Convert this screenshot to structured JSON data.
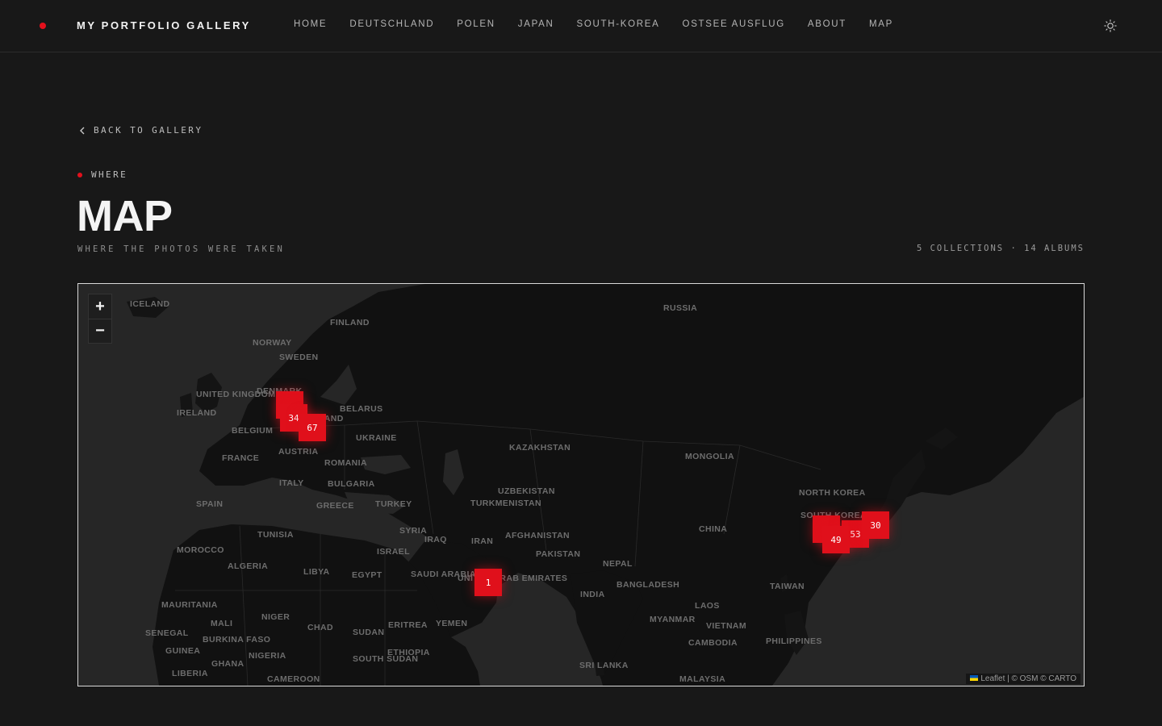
{
  "header": {
    "brand": "MY PORTFOLIO GALLERY",
    "nav": [
      "HOME",
      "DEUTSCHLAND",
      "POLEN",
      "JAPAN",
      "SOUTH-KOREA",
      "OSTSEE AUSFLUG",
      "ABOUT",
      "MAP"
    ]
  },
  "back_label": "BACK TO GALLERY",
  "eyebrow": "WHERE",
  "title": "MAP",
  "subtitle": "WHERE THE PHOTOS WERE TAKEN",
  "stats": "5 COLLECTIONS · 14 ALBUMS",
  "map": {
    "zoom_in": "+",
    "zoom_out": "−",
    "attribution": "Leaflet | © OSM © CARTO",
    "clusters": [
      {
        "name": "cluster-europe-a",
        "label": ""
      },
      {
        "name": "cluster-europe-34",
        "label": "34"
      },
      {
        "name": "cluster-europe-67",
        "label": "67"
      },
      {
        "name": "cluster-middle-east-1",
        "label": "1"
      },
      {
        "name": "cluster-korea",
        "label": "1"
      },
      {
        "name": "cluster-japan-49",
        "label": "49"
      },
      {
        "name": "cluster-japan-53",
        "label": "53"
      },
      {
        "name": "cluster-japan-30",
        "label": "30"
      }
    ],
    "labels": [
      "RUSSIA",
      "ICELAND",
      "FINLAND",
      "NORWAY",
      "SWEDEN",
      "DENMARK",
      "UNITED KINGDOM",
      "IRELAND",
      "BELGIUM",
      "POLAND",
      "BELARUS",
      "UKRAINE",
      "FRANCE",
      "AUSTRIA",
      "ROMANIA",
      "BULGARIA",
      "ITALY",
      "SPAIN",
      "GREECE",
      "TURKEY",
      "TUNISIA",
      "MOROCCO",
      "ALGERIA",
      "LIBYA",
      "EGYPT",
      "ISRAEL",
      "SYRIA",
      "IRAQ",
      "IRAN",
      "SAUDI ARABIA",
      "UNITED ARAB EMIRATES",
      "KAZAKHSTAN",
      "UZBEKISTAN",
      "TURKMENISTAN",
      "AFGHANISTAN",
      "PAKISTAN",
      "MONGOLIA",
      "CHINA",
      "NORTH KOREA",
      "SOUTH KOREA",
      "NEPAL",
      "INDIA",
      "BANGLADESH",
      "MYANMAR",
      "LAOS",
      "VIETNAM",
      "TAIWAN",
      "CAMBODIA",
      "PHILIPPINES",
      "SRI LANKA",
      "MALAYSIA",
      "MAURITANIA",
      "MALI",
      "NIGER",
      "CHAD",
      "SUDAN",
      "ERITREA",
      "YEMEN",
      "SENEGAL",
      "BURKINA FASO",
      "GUINEA",
      "GHANA",
      "NIGERIA",
      "ETHIOPIA",
      "SOUTH SUDAN",
      "LIBERIA",
      "CAMEROON"
    ]
  },
  "colors": {
    "accent": "#e3101c",
    "background": "#181818"
  }
}
